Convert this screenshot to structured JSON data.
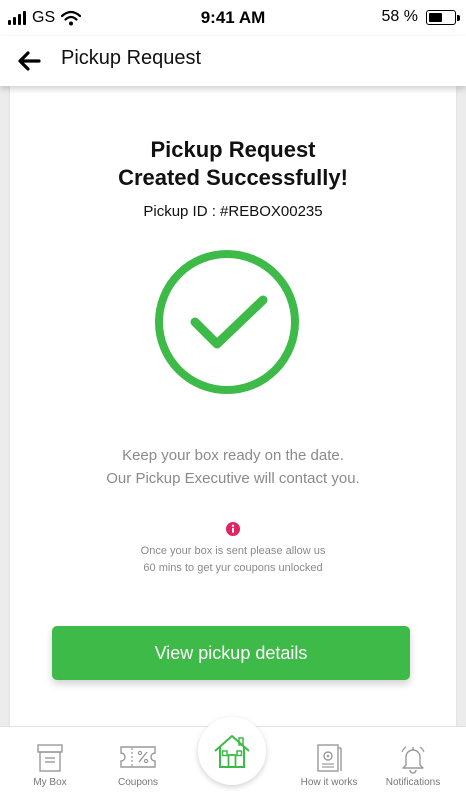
{
  "status_bar": {
    "carrier": "GS",
    "time": "9:41 AM",
    "battery": "58 %",
    "battery_level": 0.58
  },
  "header": {
    "title": "Pickup Request",
    "back_icon": "arrow-left-icon"
  },
  "main": {
    "title_line1": "Pickup Request",
    "title_line2": "Created Successfully!",
    "pickup_id": "Pickup ID : #REBOX00235",
    "message_line1": "Keep your box ready on the date.",
    "message_line2": "Our Pickup Executive will contact you.",
    "note_line1": "Once your box is sent please allow us",
    "note_line2": "60 mins to get yur coupons unlocked",
    "button_label": "View pickup details"
  },
  "bottom_nav": {
    "items": [
      {
        "label": "My Box",
        "icon": "box-icon"
      },
      {
        "label": "Coupons",
        "icon": "coupon-icon"
      },
      {
        "label": "",
        "icon": "home-icon"
      },
      {
        "label": "How it works",
        "icon": "book-gear-icon"
      },
      {
        "label": "Notifications",
        "icon": "bell-icon"
      }
    ]
  },
  "colors": {
    "accent": "#3dba48",
    "info": "#e0245e",
    "muted": "#8a8a8a"
  }
}
